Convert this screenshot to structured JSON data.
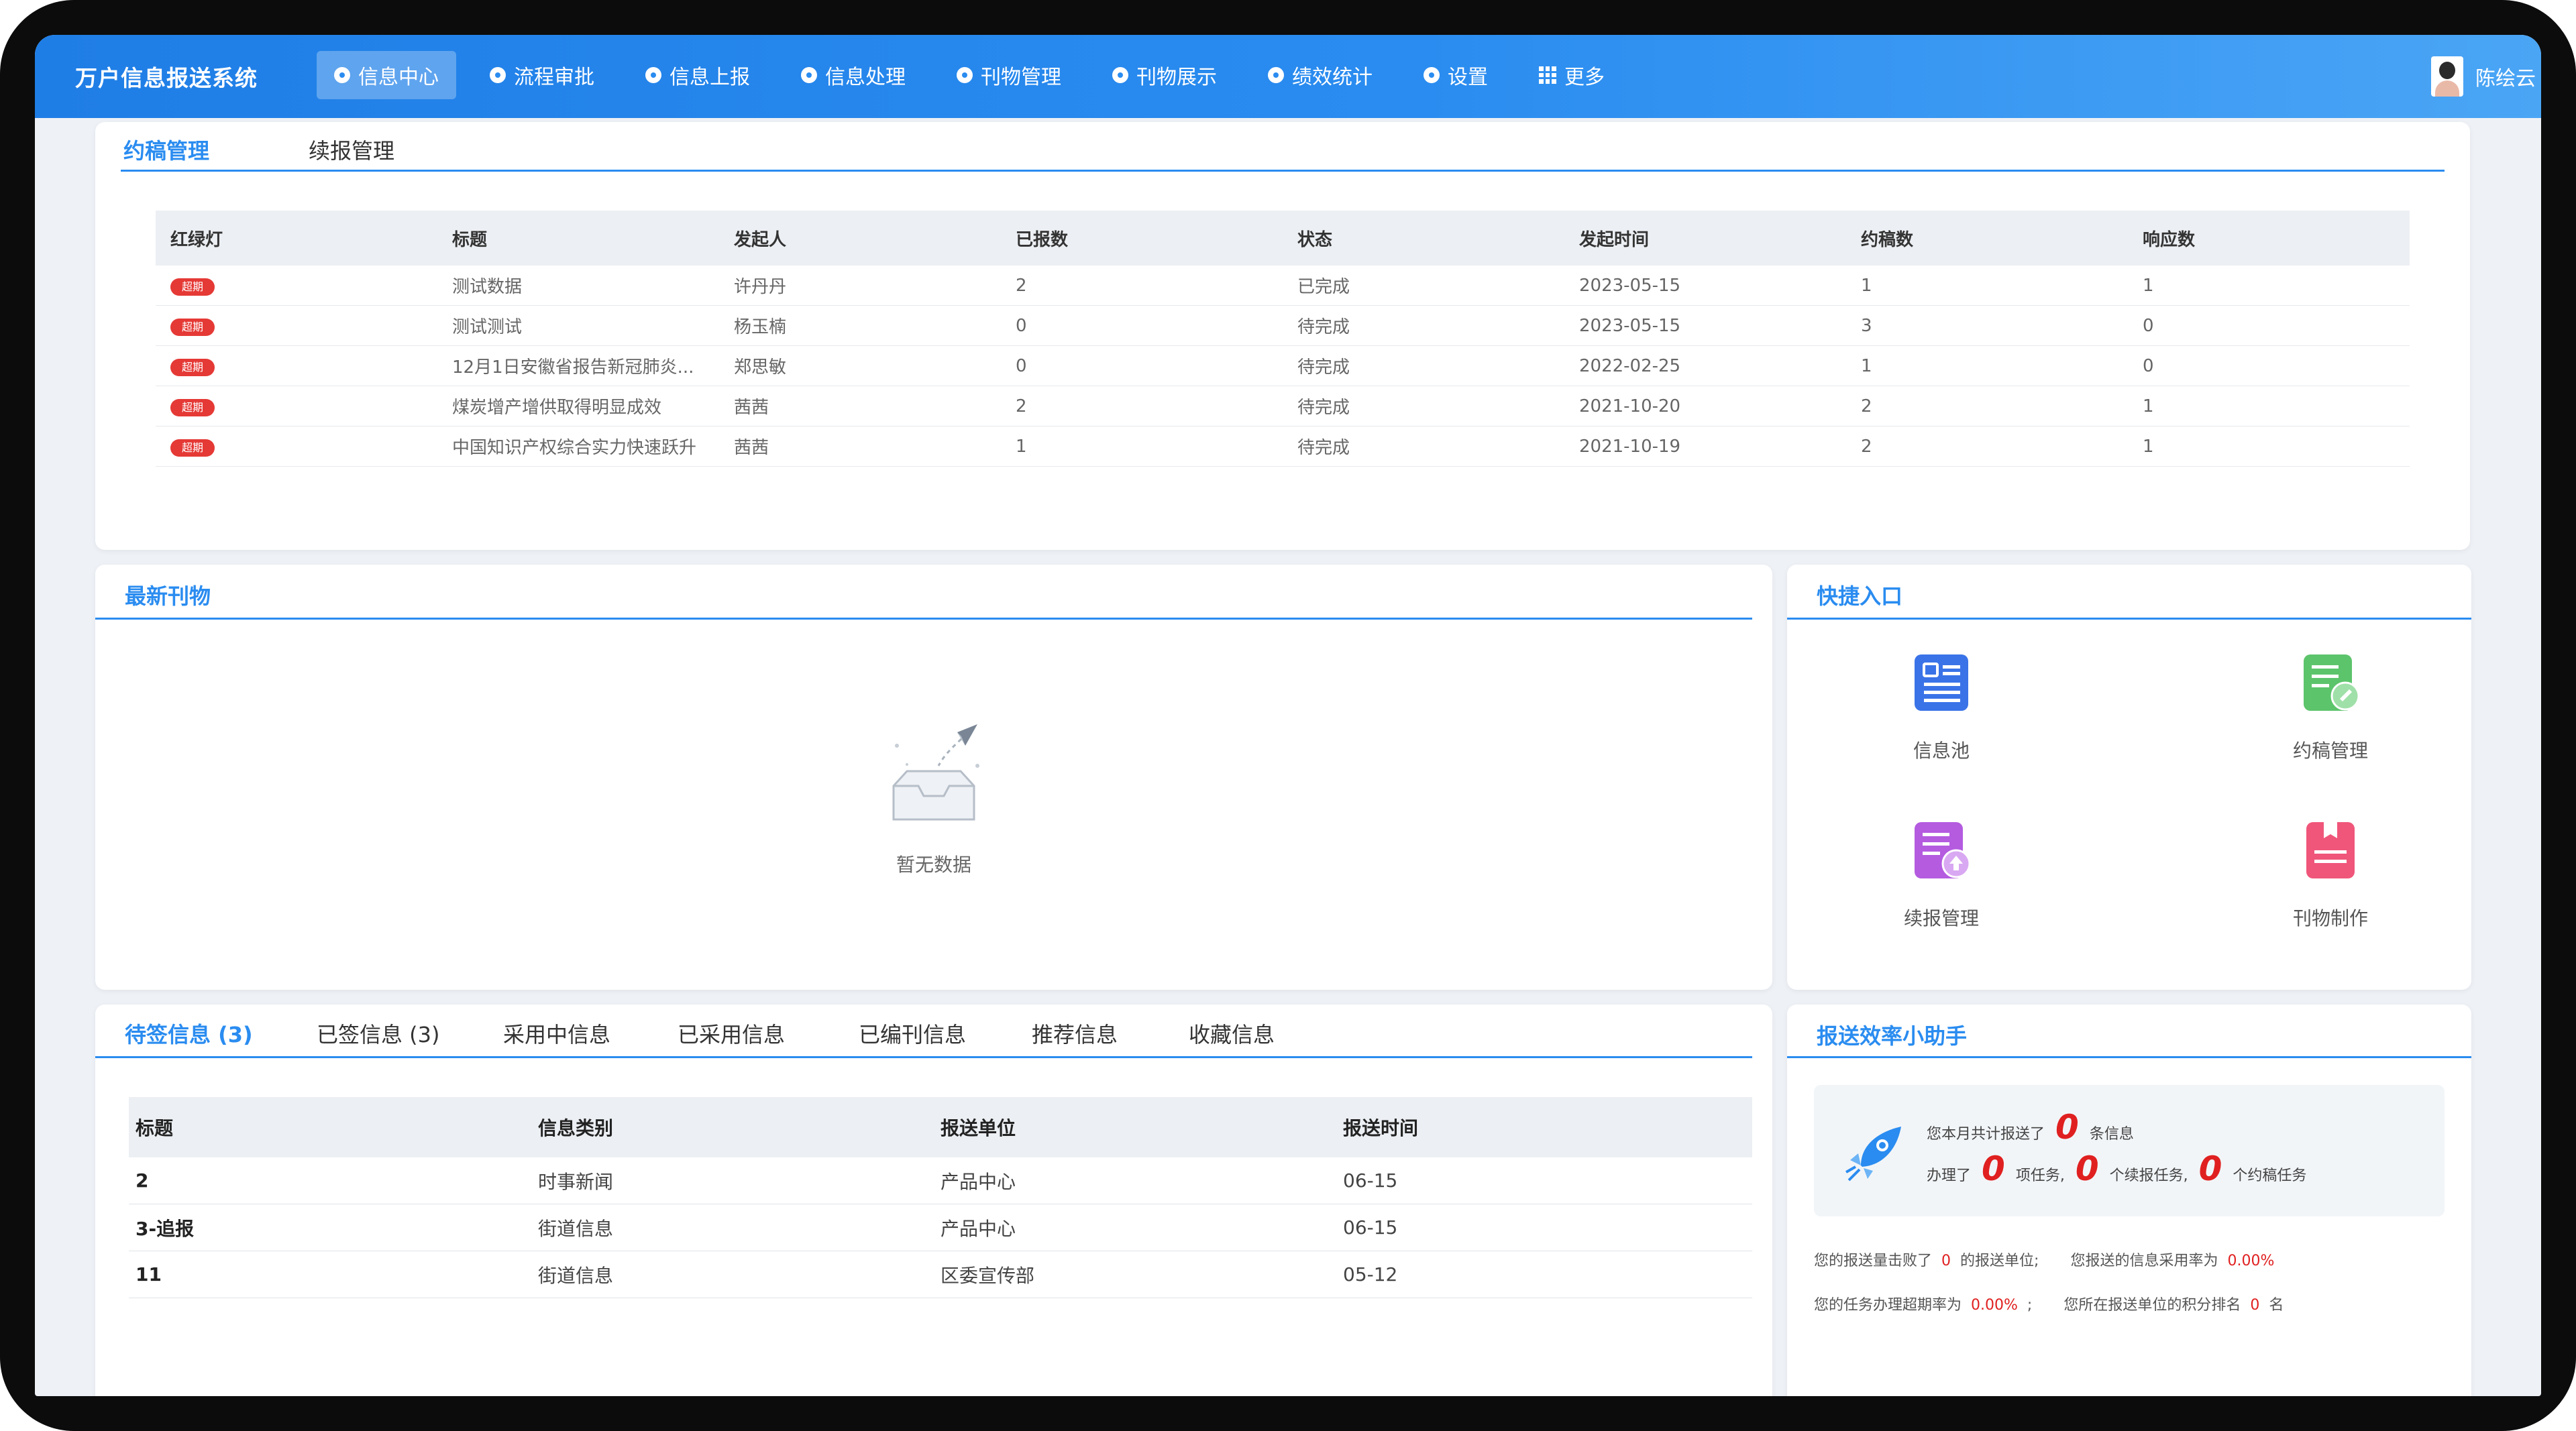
{
  "app": {
    "title": "万户信息报送系统"
  },
  "nav": [
    {
      "label": "信息中心",
      "icon": "circle-dot-icon",
      "active": true
    },
    {
      "label": "流程审批",
      "icon": "circle-dot-icon"
    },
    {
      "label": "信息上报",
      "icon": "circle-dot-icon"
    },
    {
      "label": "信息处理",
      "icon": "circle-dot-icon"
    },
    {
      "label": "刊物管理",
      "icon": "circle-dot-icon"
    },
    {
      "label": "刊物展示",
      "icon": "circle-dot-icon"
    },
    {
      "label": "绩效统计",
      "icon": "circle-dot-icon"
    },
    {
      "label": "设置",
      "icon": "circle-dot-icon"
    },
    {
      "label": "更多",
      "icon": "grid-icon"
    }
  ],
  "user": {
    "name": "陈绘云"
  },
  "manuscript_panel": {
    "tabs": [
      "约稿管理",
      "续报管理"
    ],
    "columns": [
      "红绿灯",
      "标题",
      "发起人",
      "已报数",
      "状态",
      "发起时间",
      "约稿数",
      "响应数"
    ],
    "badge_text": "超期",
    "rows": [
      [
        "测试数据",
        "许丹丹",
        "2",
        "已完成",
        "2023-05-15",
        "1",
        "1"
      ],
      [
        "测试测试",
        "杨玉楠",
        "0",
        "待完成",
        "2023-05-15",
        "3",
        "0"
      ],
      [
        "12月1日安徽省报告新冠肺炎...",
        "郑思敏",
        "0",
        "待完成",
        "2022-02-25",
        "1",
        "0"
      ],
      [
        "煤炭增产增供取得明显成效",
        "茜茜",
        "2",
        "待完成",
        "2021-10-20",
        "2",
        "1"
      ],
      [
        "中国知识产权综合实力快速跃升",
        "茜茜",
        "1",
        "待完成",
        "2021-10-19",
        "2",
        "1"
      ]
    ]
  },
  "latest_pub": {
    "title": "最新刊物",
    "empty_text": "暂无数据"
  },
  "quick_panel": {
    "title": "快捷入口",
    "items": [
      {
        "label": "信息池",
        "icon": "document-list-icon",
        "color": "#3a73e8"
      },
      {
        "label": "约稿管理",
        "icon": "document-edit-icon",
        "color": "#5cc46b"
      },
      {
        "label": "续报管理",
        "icon": "document-upload-icon",
        "color": "#b45be0"
      },
      {
        "label": "刊物制作",
        "icon": "bookmark-document-icon",
        "color": "#f0567a"
      }
    ]
  },
  "info_panel": {
    "tabs": [
      "待签信息 (3)",
      "已签信息 (3)",
      "采用中信息",
      "已采用信息",
      "已编刊信息",
      "推荐信息",
      "收藏信息"
    ],
    "columns": [
      "标题",
      "信息类别",
      "报送单位",
      "报送时间"
    ],
    "rows": [
      [
        "2",
        "时事新闻",
        "产品中心",
        "06-15"
      ],
      [
        "3-追报",
        "街道信息",
        "产品中心",
        "06-15"
      ],
      [
        "11",
        "街道信息",
        "区委宣传部",
        "05-12"
      ]
    ]
  },
  "efficiency": {
    "title": "报送效率小助手",
    "line1_prefix": "您本月共计报送了",
    "line1_num": "0",
    "line1_suffix": "条信息",
    "line2_prefix": "办理了",
    "line2_num1": "0",
    "line2_mid1": "项任务,",
    "line2_num2": "0",
    "line2_mid2": "个续报任务,",
    "line2_num3": "0",
    "line2_suffix": "个约稿任务",
    "stat1_a": "您的报送量击败了",
    "stat1_v": "0",
    "stat1_b": "的报送单位;",
    "stat2_a": "您报送的信息采用率为",
    "stat2_v": "0.00%",
    "stat3_a": "您的任务办理超期率为",
    "stat3_v": "0.00%",
    "stat3_b": ";",
    "stat4_a": "您所在报送单位的积分排名",
    "stat4_v": "0",
    "stat4_b": "名"
  }
}
